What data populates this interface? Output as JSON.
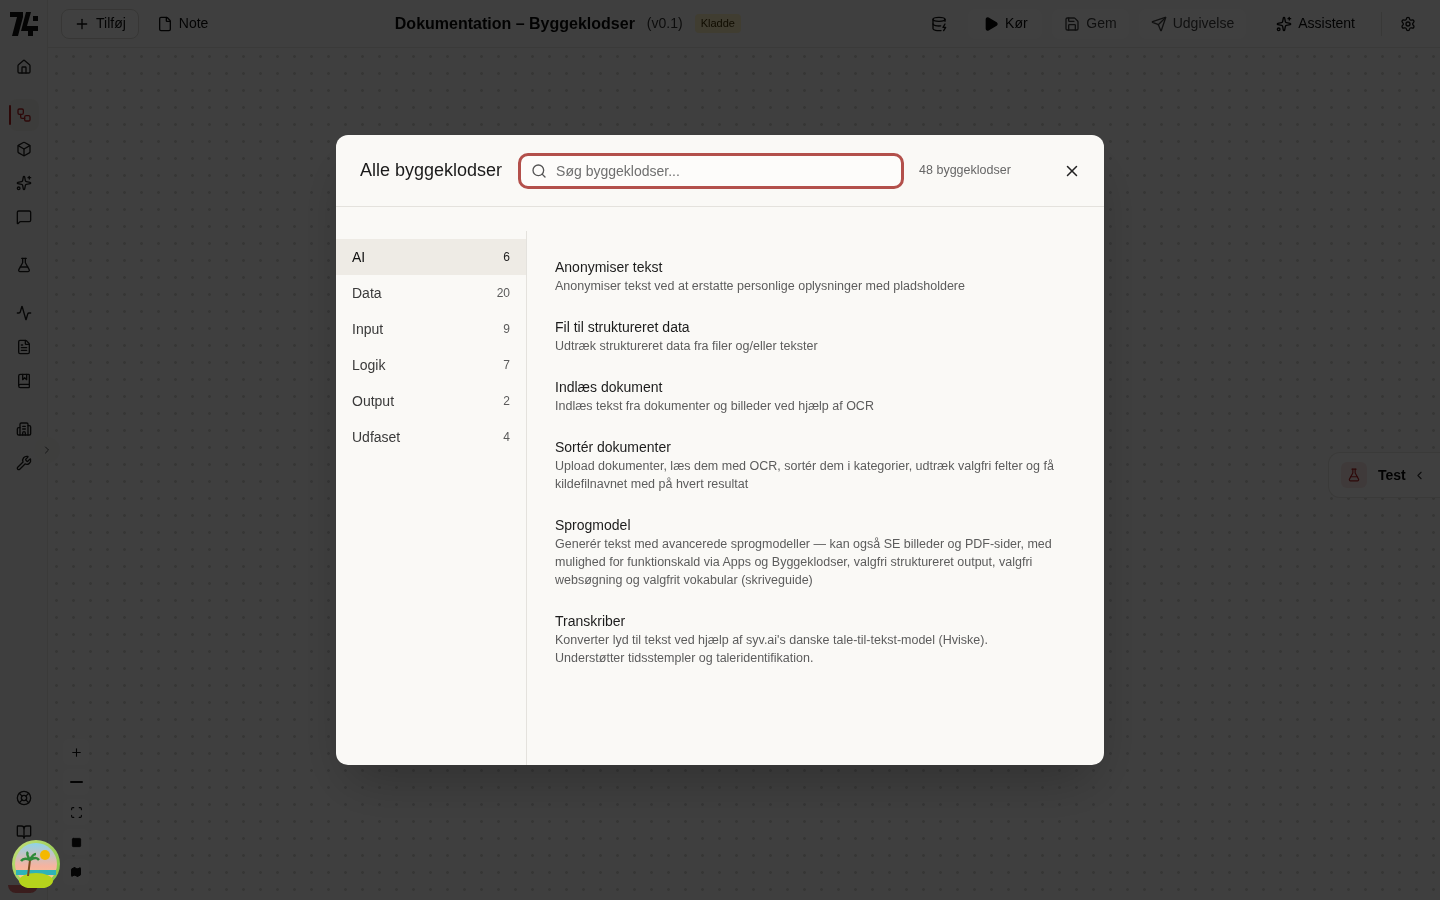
{
  "sidebar": {
    "groups": [
      {
        "items": [
          {
            "selected": false
          }
        ]
      },
      {
        "items": [
          {
            "selected": true
          },
          {
            "selected": false
          },
          {
            "selected": false
          },
          {
            "selected": false
          }
        ]
      },
      {
        "items": [
          {
            "selected": false
          }
        ]
      },
      {
        "items": [
          {
            "selected": false
          },
          {
            "selected": false
          },
          {
            "selected": false
          }
        ]
      },
      {
        "items": [
          {
            "selected": false
          },
          {
            "selected": false
          }
        ]
      }
    ]
  },
  "toolbar": {
    "add_button": "Tilføj",
    "note_button": "Note",
    "title": "Dokumentation – Byggeklodser",
    "version": "(v0.1)",
    "badge": "Kladde",
    "actions": [
      {
        "label": "Kør",
        "kind": "button",
        "disabled": false
      },
      {
        "label": "Gem",
        "kind": "button",
        "disabled": true
      },
      {
        "label": "Udgivelse",
        "kind": "button",
        "disabled": true
      },
      {
        "label": "Assistent",
        "kind": "ghost",
        "disabled": false
      }
    ]
  },
  "test_panel": {
    "label": "Test"
  },
  "dialog": {
    "title": "Alle byggeklodser",
    "search": {
      "placeholder": "Søg byggeklodser..."
    },
    "count": "48 byggeklodser",
    "categories": [
      {
        "label": "AI",
        "count": "6",
        "selected": true
      },
      {
        "label": "Data",
        "count": "20",
        "selected": false
      },
      {
        "label": "Input",
        "count": "9",
        "selected": false
      },
      {
        "label": "Logik",
        "count": "7",
        "selected": false
      },
      {
        "label": "Output",
        "count": "2",
        "selected": false
      },
      {
        "label": "Udfaset",
        "count": "4",
        "selected": false
      }
    ],
    "blocks": [
      {
        "title": "Anonymiser tekst",
        "description": "Anonymiser tekst ved at erstatte personlige oplysninger med pladsholdere"
      },
      {
        "title": "Fil til struktureret data",
        "description": "Udtræk struktureret data fra filer og/eller tekster"
      },
      {
        "title": "Indlæs dokument",
        "description": "Indlæs tekst fra dokumenter og billeder ved hjælp af OCR"
      },
      {
        "title": "Sortér dokumenter",
        "description": "Upload dokumenter, læs dem med OCR, sortér dem i kategorier, udtræk valgfri felter og få kildefilnavnet med på hvert resultat"
      },
      {
        "title": "Sprogmodel",
        "description": "Generér tekst med avancerede sprogmodeller — kan også SE billeder og PDF-sider, med mulighed for funktionskald via Apps og Byggeklodser, valgfri struktureret output, valgfri websøgning og valgfrit vokabular (skriveguide)"
      },
      {
        "title": "Transkriber",
        "description": "Konverter lyd til tekst ved hjælp af syv.ai's danske tale-til-tekst-model (Hviske). Understøtter tidsstempler og taleridentifikation."
      }
    ]
  }
}
